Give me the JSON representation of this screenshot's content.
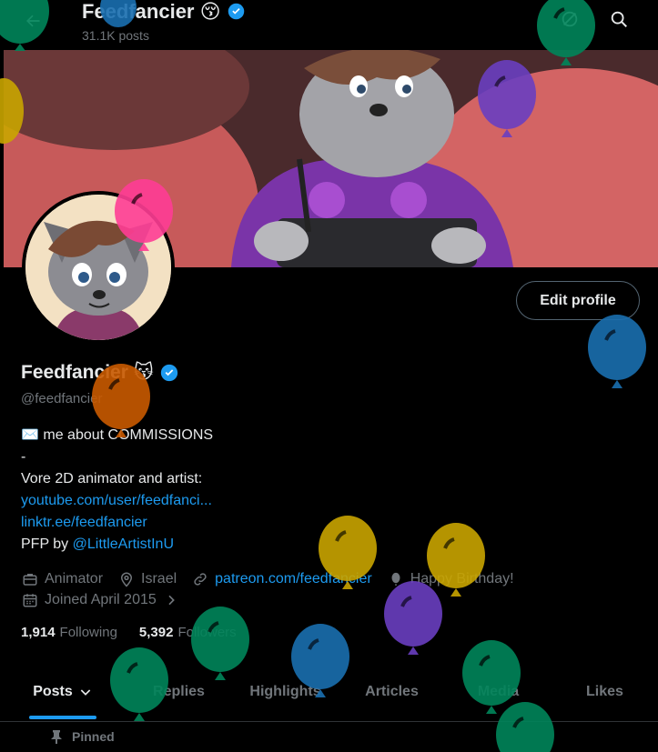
{
  "header": {
    "title": "Feedfancier",
    "title_emoji": "😚",
    "posts_count": "31.1K posts"
  },
  "profile": {
    "display_name": "Feedfancier",
    "name_emoji": "😽",
    "handle": "@feedfancier",
    "edit_profile_label": "Edit profile",
    "bio": {
      "line1_emoji": "✉️",
      "line1_text": "me about COMMISSIONS",
      "line2": "-",
      "line3": "Vore 2D animator and artist:",
      "link1": "youtube.com/user/feedfanci...",
      "link2": "linktr.ee/feedfancier",
      "pfp_prefix": "PFP by ",
      "pfp_link": "@LittleArtistInU"
    },
    "meta": {
      "category": "Animator",
      "location": "Israel",
      "website": "patreon.com/feedfancier",
      "birthday": "Happy Birthday!",
      "joined": "Joined April 2015"
    },
    "following_count": "1,914",
    "following_label": "Following",
    "followers_count": "5,392",
    "followers_label": "Followers"
  },
  "tabs": [
    "Posts",
    "Replies",
    "Highlights",
    "Articles",
    "Media",
    "Likes"
  ],
  "pinned_label": "Pinned",
  "colors": {
    "accent": "#1d9bf0",
    "verified": "#1d9bf0",
    "muted": "#71767b",
    "text": "#e7e9ea",
    "background": "#000000"
  },
  "icons": [
    "back-arrow-icon",
    "no-ads-icon",
    "search-icon",
    "verified-icon",
    "briefcase-icon",
    "location-icon",
    "link-icon",
    "balloon-icon",
    "calendar-icon",
    "chevron-right-icon",
    "chevron-down-icon",
    "pin-icon"
  ]
}
